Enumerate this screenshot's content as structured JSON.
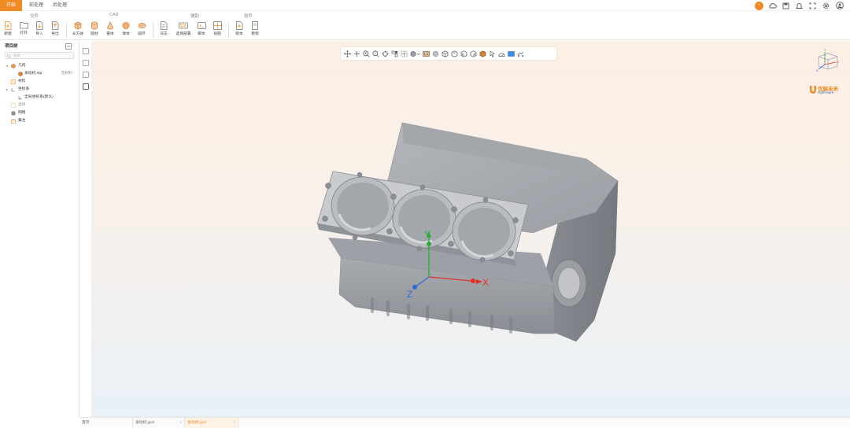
{
  "menu": {
    "tabs": [
      "开始",
      "前处理",
      "后处理"
    ]
  },
  "ribbon": {
    "groups": [
      "文件",
      "CAD",
      "辅助",
      "软件"
    ],
    "buttons": [
      "新建",
      "打开",
      "导入",
      "导出",
      "长方体",
      "圆柱",
      "锥体",
      "球体",
      "圆环",
      "日志",
      "选择部署",
      "脚本",
      "视图",
      "版本",
      "教程"
    ]
  },
  "status": {
    "badge": "!"
  },
  "tree": {
    "title": "项目树",
    "search_placeholder": "搜索",
    "items": [
      "几何",
      "发动机.stp",
      "无材料",
      "材料",
      "坐标系",
      "全局坐标系(默认)",
      "选择",
      "网格",
      "集合"
    ]
  },
  "logo": {
    "name": "优解未来",
    "sub": "OptFuture"
  },
  "axes": {
    "x": "X",
    "y": "Y",
    "z": "Z"
  },
  "tabs": [
    "首页",
    "发动机.yjwl",
    "发动机.yjwl"
  ],
  "colors": {
    "accent": "#f08a24",
    "axis_x": "#e0302a",
    "axis_y": "#2eaa3a",
    "axis_z": "#2a6fd6",
    "model": "#9a9da3"
  }
}
